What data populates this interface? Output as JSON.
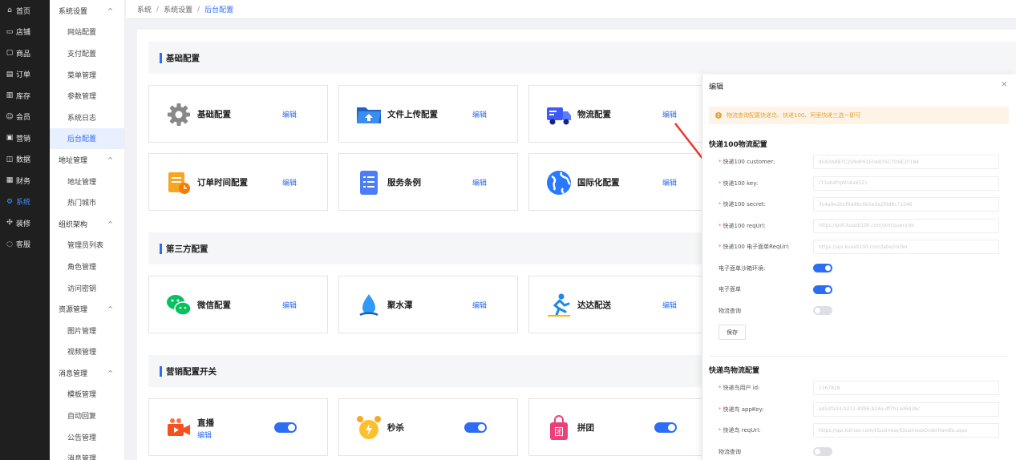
{
  "nav1": [
    {
      "label": "首页",
      "icon": "home-icon"
    },
    {
      "label": "店铺",
      "icon": "store-icon"
    },
    {
      "label": "商品",
      "icon": "goods-icon"
    },
    {
      "label": "订单",
      "icon": "order-icon"
    },
    {
      "label": "库存",
      "icon": "inventory-icon"
    },
    {
      "label": "会员",
      "icon": "member-icon"
    },
    {
      "label": "营销",
      "icon": "gift-icon"
    },
    {
      "label": "数据",
      "icon": "data-icon"
    },
    {
      "label": "财务",
      "icon": "finance-icon"
    },
    {
      "label": "系统",
      "icon": "settings-icon"
    },
    {
      "label": "装修",
      "icon": "decorate-icon"
    },
    {
      "label": "客服",
      "icon": "chat-icon"
    }
  ],
  "nav2": {
    "groups": [
      {
        "label": "系统设置",
        "items": [
          "网站配置",
          "支付配置",
          "菜单管理",
          "参数管理",
          "系统日志",
          "后台配置"
        ]
      },
      {
        "label": "地址管理",
        "items": [
          "地址管理",
          "热门城市"
        ]
      },
      {
        "label": "组织架构",
        "items": [
          "管理员列表",
          "角色管理",
          "访问密钥"
        ]
      },
      {
        "label": "资源管理",
        "items": [
          "图片管理",
          "视频管理"
        ]
      },
      {
        "label": "消息管理",
        "items": [
          "模板管理",
          "自动回复",
          "公告管理",
          "消息管理"
        ]
      }
    ]
  },
  "breadcrumb": {
    "items": [
      "系统",
      "系统设置"
    ],
    "current": "后台配置",
    "sep": "/"
  },
  "sections": {
    "basic": "基础配置",
    "third": "第三方配置",
    "marketing": "营销配置开关"
  },
  "cards": {
    "basic": [
      {
        "title": "基础配置",
        "edit": "编辑"
      },
      {
        "title": "文件上传配置",
        "edit": "编辑"
      },
      {
        "title": "物流配置",
        "edit": "编辑"
      },
      {
        "title": "订单时间配置",
        "edit": "编辑"
      },
      {
        "title": "服务条例",
        "edit": "编辑"
      },
      {
        "title": "国际化配置",
        "edit": "编辑"
      }
    ],
    "third": [
      {
        "title": "微信配置",
        "edit": "编辑"
      },
      {
        "title": "聚水潭",
        "edit": "编辑"
      },
      {
        "title": "达达配送",
        "edit": "编辑"
      }
    ],
    "marketing": [
      {
        "title": "直播",
        "sub": "编辑",
        "on": true
      },
      {
        "title": "秒杀",
        "on": true
      },
      {
        "title": "拼团",
        "on": true
      }
    ]
  },
  "modal": {
    "title": "编辑",
    "close": "×",
    "alert_icon": "!",
    "alert": "物流查询配置快递鸟、快递100、阿里快递三选一即可",
    "kd100": {
      "title": "快递100物流配置",
      "fields": [
        {
          "label": "快递100 customer:",
          "value": "4583A8B7C2D94F61E0AB35C7D9E2F184"
        },
        {
          "label": "快递100 key:",
          "value": "rT3sKdPqWnAx8521"
        },
        {
          "label": "快递100 secret:",
          "value": "7c4a9e2b1f0d48c6b5e3a2f9d8c71046"
        },
        {
          "label": "快递100 reqUrl:",
          "value": "https://poll.kuaidi100.com/poll/query.do"
        },
        {
          "label": "快递100 电子面单ReqUrl:",
          "value": "https://api.kuaidi100.com/label/order"
        }
      ],
      "switches": [
        {
          "label": "电子面单沙箱环境:",
          "on": true
        },
        {
          "label": "电子面单",
          "on": true
        },
        {
          "label": "物流查询",
          "on": false
        }
      ],
      "save": "保存"
    },
    "kdn": {
      "title": "快递鸟物流配置",
      "fields": [
        {
          "label": "快递鸟用户 id:",
          "value": "1367828"
        },
        {
          "label": "快递鸟 appKey:",
          "value": "ad52fa34-b211-4996-b24e-df7b1ad6d36c"
        },
        {
          "label": "快递鸟 reqUrl:",
          "value": "https://api.kdniao.com/Ebusiness/EbusinessOrderHandle.aspx"
        }
      ],
      "switches": [
        {
          "label": "物流查询",
          "on": false
        }
      ]
    }
  },
  "colors": {
    "accent": "#2d6cf5",
    "sidebar": "#1f1f1f",
    "warning": "#e6a23c"
  }
}
